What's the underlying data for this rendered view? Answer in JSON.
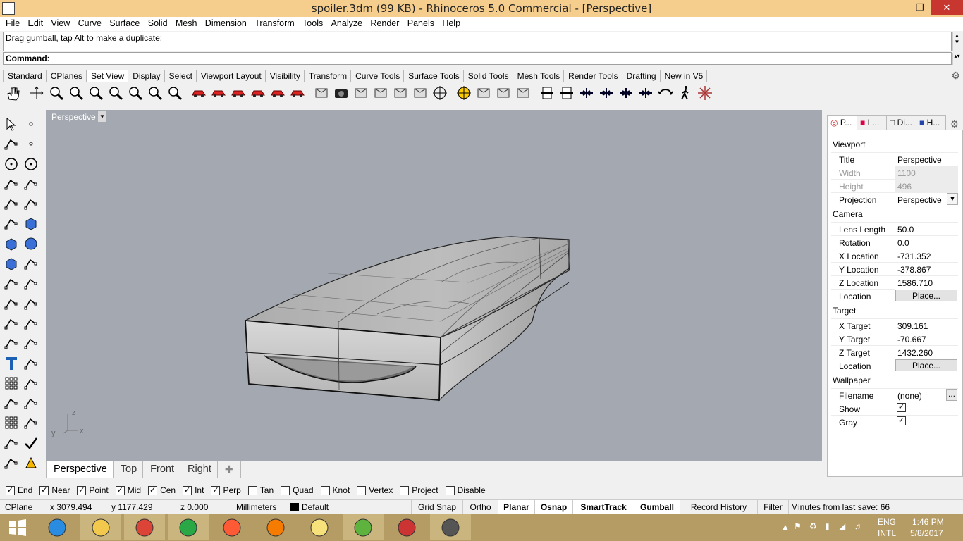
{
  "window": {
    "title": "spoiler.3dm (99 KB) - Rhinoceros 5.0 Commercial - [Perspective]"
  },
  "menu": [
    "File",
    "Edit",
    "View",
    "Curve",
    "Surface",
    "Solid",
    "Mesh",
    "Dimension",
    "Transform",
    "Tools",
    "Analyze",
    "Render",
    "Panels",
    "Help"
  ],
  "command": {
    "history": "Drag gumball, tap Alt to make a duplicate:",
    "prompt": "Command:"
  },
  "toolbar_tabs": [
    "Standard",
    "CPlanes",
    "Set View",
    "Display",
    "Select",
    "Viewport Layout",
    "Visibility",
    "Transform",
    "Curve Tools",
    "Surface Tools",
    "Solid Tools",
    "Mesh Tools",
    "Render Tools",
    "Drafting",
    "New in V5"
  ],
  "active_toolbar_tab": "Set View",
  "toolbar_icons": [
    "pan-hand-icon",
    "rotate-view-icon",
    "zoom-dynamic-icon",
    "zoom-extents-icon",
    "zoom-window-icon",
    "zoom-selected-icon",
    "zoom-target-icon",
    "zoom-out-icon",
    "zoom-1to1-icon",
    "view-front-car-icon",
    "view-back-car-icon",
    "view-left-car-icon",
    "view-right-car-icon",
    "view-top-car-icon",
    "view-perspective-car-icon",
    "camera-set-icon",
    "camera-icon",
    "named-view-save-icon",
    "named-view-icon",
    "place-target-icon",
    "light-target-icon",
    "target-icon",
    "target-gumball-icon",
    "cplane-origin-icon",
    "blocks-view-icon",
    "cube-view-icon",
    "elevation-1-icon",
    "elevation-2-icon",
    "plane-1-icon",
    "plane-2-icon",
    "plane-3-icon",
    "plane-4-icon",
    "undo-view-icon",
    "walk-icon",
    "star-burst-icon"
  ],
  "left_tools": [
    "select-arrow-icon",
    "point-icon",
    "polyline-icon",
    "curve-points-icon",
    "circle-icon",
    "ellipse-icon",
    "arc-icon",
    "rectangle-icon",
    "polygon-icon",
    "fillet-curve-icon",
    "surface-corner-icon",
    "extrude-icon",
    "box-icon",
    "sphere-icon",
    "cylinder-icon",
    "plane-surface-icon",
    "explode-icon",
    "trim-icon",
    "split-icon",
    "join-icon",
    "boolean-icon",
    "group-icon",
    "move-icon",
    "rotate-icon",
    "text-icon",
    "scale-icon",
    "array-icon",
    "mirror-icon",
    "mesh-icon",
    "dimension-icon",
    "grid-icon",
    "align-icon",
    "layer-icon",
    "check-icon",
    "hide-icon",
    "render-icon"
  ],
  "viewport": {
    "name": "Perspective",
    "axis_x": "x",
    "axis_y": "y",
    "axis_z": "z"
  },
  "viewport_tabs": [
    "Perspective",
    "Top",
    "Front",
    "Right"
  ],
  "active_viewport_tab": "Perspective",
  "osnaps": [
    {
      "label": "End",
      "checked": true
    },
    {
      "label": "Near",
      "checked": true
    },
    {
      "label": "Point",
      "checked": true
    },
    {
      "label": "Mid",
      "checked": true
    },
    {
      "label": "Cen",
      "checked": true
    },
    {
      "label": "Int",
      "checked": true
    },
    {
      "label": "Perp",
      "checked": true
    },
    {
      "label": "Tan",
      "checked": false
    },
    {
      "label": "Quad",
      "checked": false
    },
    {
      "label": "Knot",
      "checked": false
    },
    {
      "label": "Vertex",
      "checked": false
    },
    {
      "label": "Project",
      "checked": false
    },
    {
      "label": "Disable",
      "checked": false
    }
  ],
  "status": {
    "cplane": "CPlane",
    "x": "x 3079.494",
    "y": "y 1177.429",
    "z": "z 0.000",
    "units": "Millimeters",
    "layer": "Default",
    "grid_snap": "Grid Snap",
    "ortho": "Ortho",
    "planar": "Planar",
    "osnap": "Osnap",
    "smarttrack": "SmartTrack",
    "gumball": "Gumball",
    "record_history": "Record History",
    "filter": "Filter",
    "save": "Minutes from last save: 66"
  },
  "panel": {
    "tabs": [
      "P...",
      "L...",
      "Di...",
      "H..."
    ],
    "sections": {
      "viewport": "Viewport",
      "camera": "Camera",
      "target": "Target",
      "wallpaper": "Wallpaper"
    },
    "viewport_rows": [
      {
        "label": "Title",
        "value": "Perspective"
      },
      {
        "label": "Width",
        "value": "1100"
      },
      {
        "label": "Height",
        "value": "496"
      },
      {
        "label": "Projection",
        "value": "Perspective"
      }
    ],
    "camera_rows": [
      {
        "label": "Lens Length",
        "value": "50.0"
      },
      {
        "label": "Rotation",
        "value": "0.0"
      },
      {
        "label": "X Location",
        "value": "-731.352"
      },
      {
        "label": "Y Location",
        "value": "-378.867"
      },
      {
        "label": "Z Location",
        "value": "1586.710"
      },
      {
        "label": "Location",
        "value": "Place..."
      }
    ],
    "target_rows": [
      {
        "label": "X Target",
        "value": "309.161"
      },
      {
        "label": "Y Target",
        "value": "-70.667"
      },
      {
        "label": "Z Target",
        "value": "1432.260"
      },
      {
        "label": "Location",
        "value": "Place..."
      }
    ],
    "wallpaper_rows": [
      {
        "label": "Filename",
        "value": "(none)"
      },
      {
        "label": "Show",
        "value": "checked"
      },
      {
        "label": "Gray",
        "value": "checked"
      }
    ],
    "dots": "..."
  },
  "taskbar": {
    "apps": [
      "ie-icon",
      "file-explorer-icon",
      "chrome-icon",
      "store-icon",
      "screenshot-tool-icon",
      "firefox-icon",
      "sticky-notes-icon",
      "utorrent-icon",
      "snipping-tool-icon",
      "rhino-icon"
    ],
    "lang": "ENG",
    "layout": "INTL",
    "time": "1:46 PM",
    "date": "5/8/2017"
  }
}
